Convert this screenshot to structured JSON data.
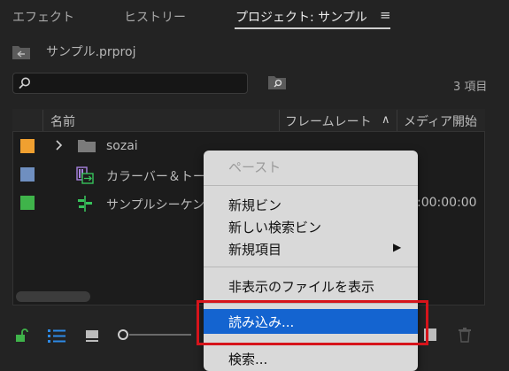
{
  "tabs": [
    {
      "label": "エフェクト"
    },
    {
      "label": "ヒストリー"
    },
    {
      "label": "プロジェクト: サンプル"
    }
  ],
  "tabs_menu_icon": "≡",
  "project": {
    "name": "サンプル.prproj"
  },
  "search": {
    "placeholder": "",
    "value": ""
  },
  "item_count": "3 項目",
  "columns": [
    "名前",
    "フレームレート",
    "メディア開始"
  ],
  "rows": [
    {
      "swatch_color": "#f0a030",
      "icon": "folder-icon",
      "name": "sozai",
      "expanded": false,
      "media_start": ""
    },
    {
      "swatch_color": "#6f8fc0",
      "icon": "color-bars-icon",
      "name": "カラーバー＆トー",
      "media_start": ""
    },
    {
      "swatch_color": "#3fb44a",
      "icon": "sequence-icon",
      "name": "サンプルシーケン",
      "media_start": ":00:00:00"
    }
  ],
  "context_menu": {
    "items": [
      {
        "label": "ペースト",
        "disabled": true
      },
      {
        "label": "新規ビン"
      },
      {
        "label": "新しい検索ビン"
      },
      {
        "label": "新規項目",
        "submenu": true
      },
      {
        "label": "非表示のファイルを表示"
      },
      {
        "label": "読み込み...",
        "highlighted": true
      },
      {
        "label": "検索..."
      }
    ]
  },
  "colors": {
    "panel_bg": "#232323",
    "menu_bg": "#d9d9d9",
    "highlight": "#1464d0",
    "annotation_outline": "#d6141b",
    "toolbar_icon_accent": "#2d8ae6",
    "lock_icon": "#3fb44a"
  },
  "toolbar": {
    "icons": [
      "lock-open-icon",
      "list-view-icon",
      "icon-view-icon",
      "zoom-slider",
      "new-item-icon",
      "trash-icon"
    ]
  }
}
